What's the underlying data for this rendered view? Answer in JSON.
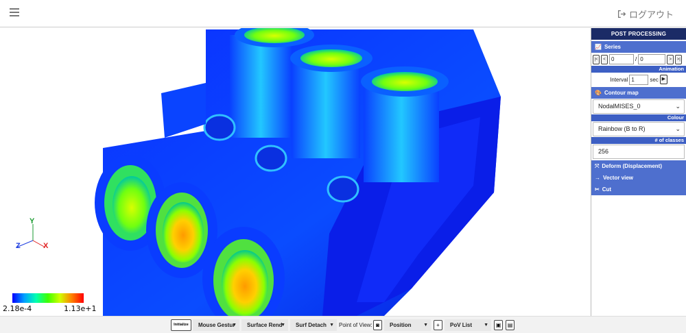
{
  "header": {
    "logout_label": "ログアウト"
  },
  "legend": {
    "min": "2.18e-4",
    "max": "1.13e+1"
  },
  "axes": {
    "x": "X",
    "y": "Y",
    "z": "Z"
  },
  "panel": {
    "title": "POST PROCESSING",
    "series_label": "Series",
    "series_current": "0",
    "series_total": "0",
    "series_sep": "/",
    "animation_label": "Animation",
    "interval_label": "Interval",
    "interval_value": "1",
    "interval_unit": "sec",
    "contour_label": "Contour map",
    "contour_value": "NodalMISES_0",
    "colour_label": "Colour",
    "colour_value": "Rainbow (B to R)",
    "classes_label": "# of classes",
    "classes_value": "256",
    "deform_label": "Deform (Displacement)",
    "vector_label": "Vector view",
    "cut_label": "Cut"
  },
  "toolbar": {
    "initialize": "Initialize",
    "mouse_gesture": "Mouse Gestur",
    "surface_render": "Surface Rend",
    "surf_detach": "Surf Detach",
    "pov_label": "Point of View:",
    "pov_value": "Position",
    "pov_list": "PoV List"
  },
  "colors": {
    "panel_title_bg": "#1b2b66",
    "section_bg": "#4e6fce",
    "model_blue": "#0a24ff"
  }
}
